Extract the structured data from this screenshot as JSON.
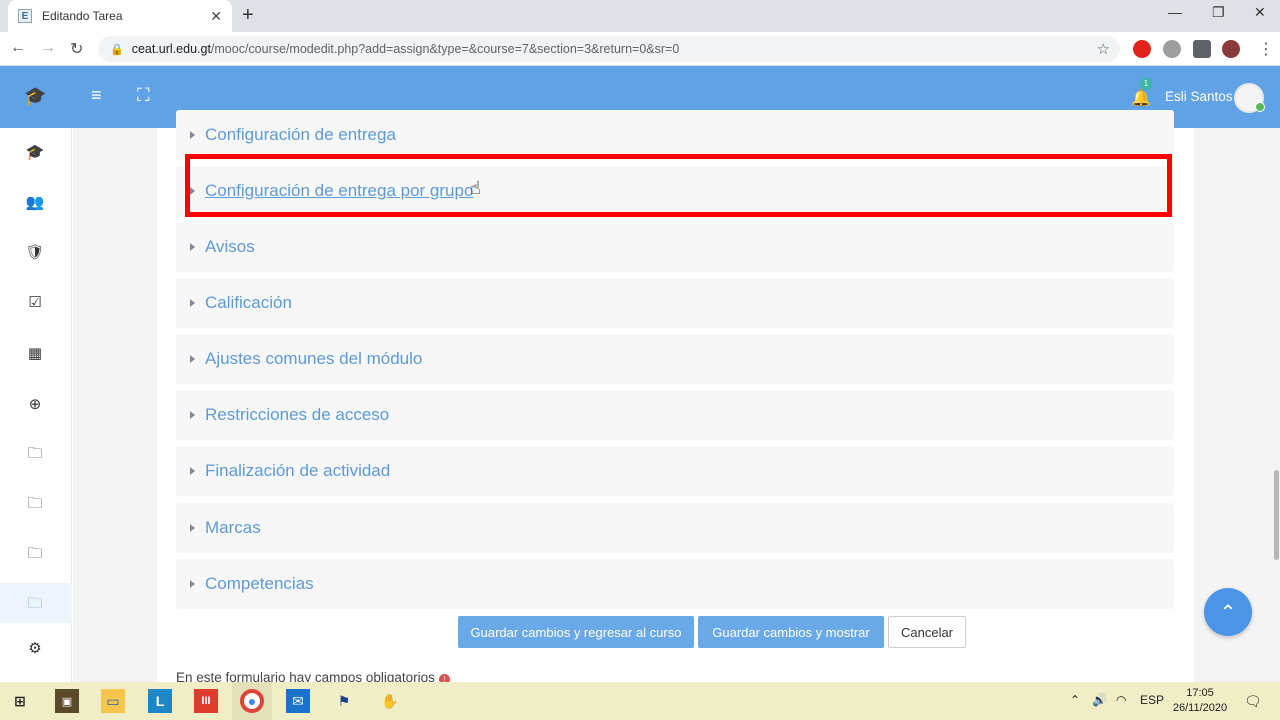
{
  "browser": {
    "tab_title": "Editando Tarea",
    "tab_favicon": "E",
    "new_tab": "+",
    "url_host": "ceat.url.edu.gt",
    "url_path": "/mooc/course/modedit.php?add=assign&type=&course=7&section=3&return=0&sr=0"
  },
  "navbar": {
    "notification_count": "1",
    "user_name": "Esli Santos"
  },
  "sections": [
    {
      "label": "Configuración de entrega"
    },
    {
      "label": "Configuración de entrega por grupo"
    },
    {
      "label": "Avisos"
    },
    {
      "label": "Calificación"
    },
    {
      "label": "Ajustes comunes del módulo"
    },
    {
      "label": "Restricciones de acceso"
    },
    {
      "label": "Finalización de actividad"
    },
    {
      "label": "Marcas"
    },
    {
      "label": "Competencias"
    }
  ],
  "buttons": {
    "save_return": "Guardar cambios y regresar al curso",
    "save_show": "Guardar cambios y mostrar",
    "cancel": "Cancelar"
  },
  "required_note": "En este formulario hay campos obligatorios",
  "taskbar": {
    "language": "ESP",
    "time": "17:05",
    "date": "26/11/2020"
  },
  "colors": {
    "navbar": "#5fa2e6",
    "link": "#5d9ad6",
    "highlight": "#ff0000",
    "primary_button": "#6aa9e8"
  }
}
